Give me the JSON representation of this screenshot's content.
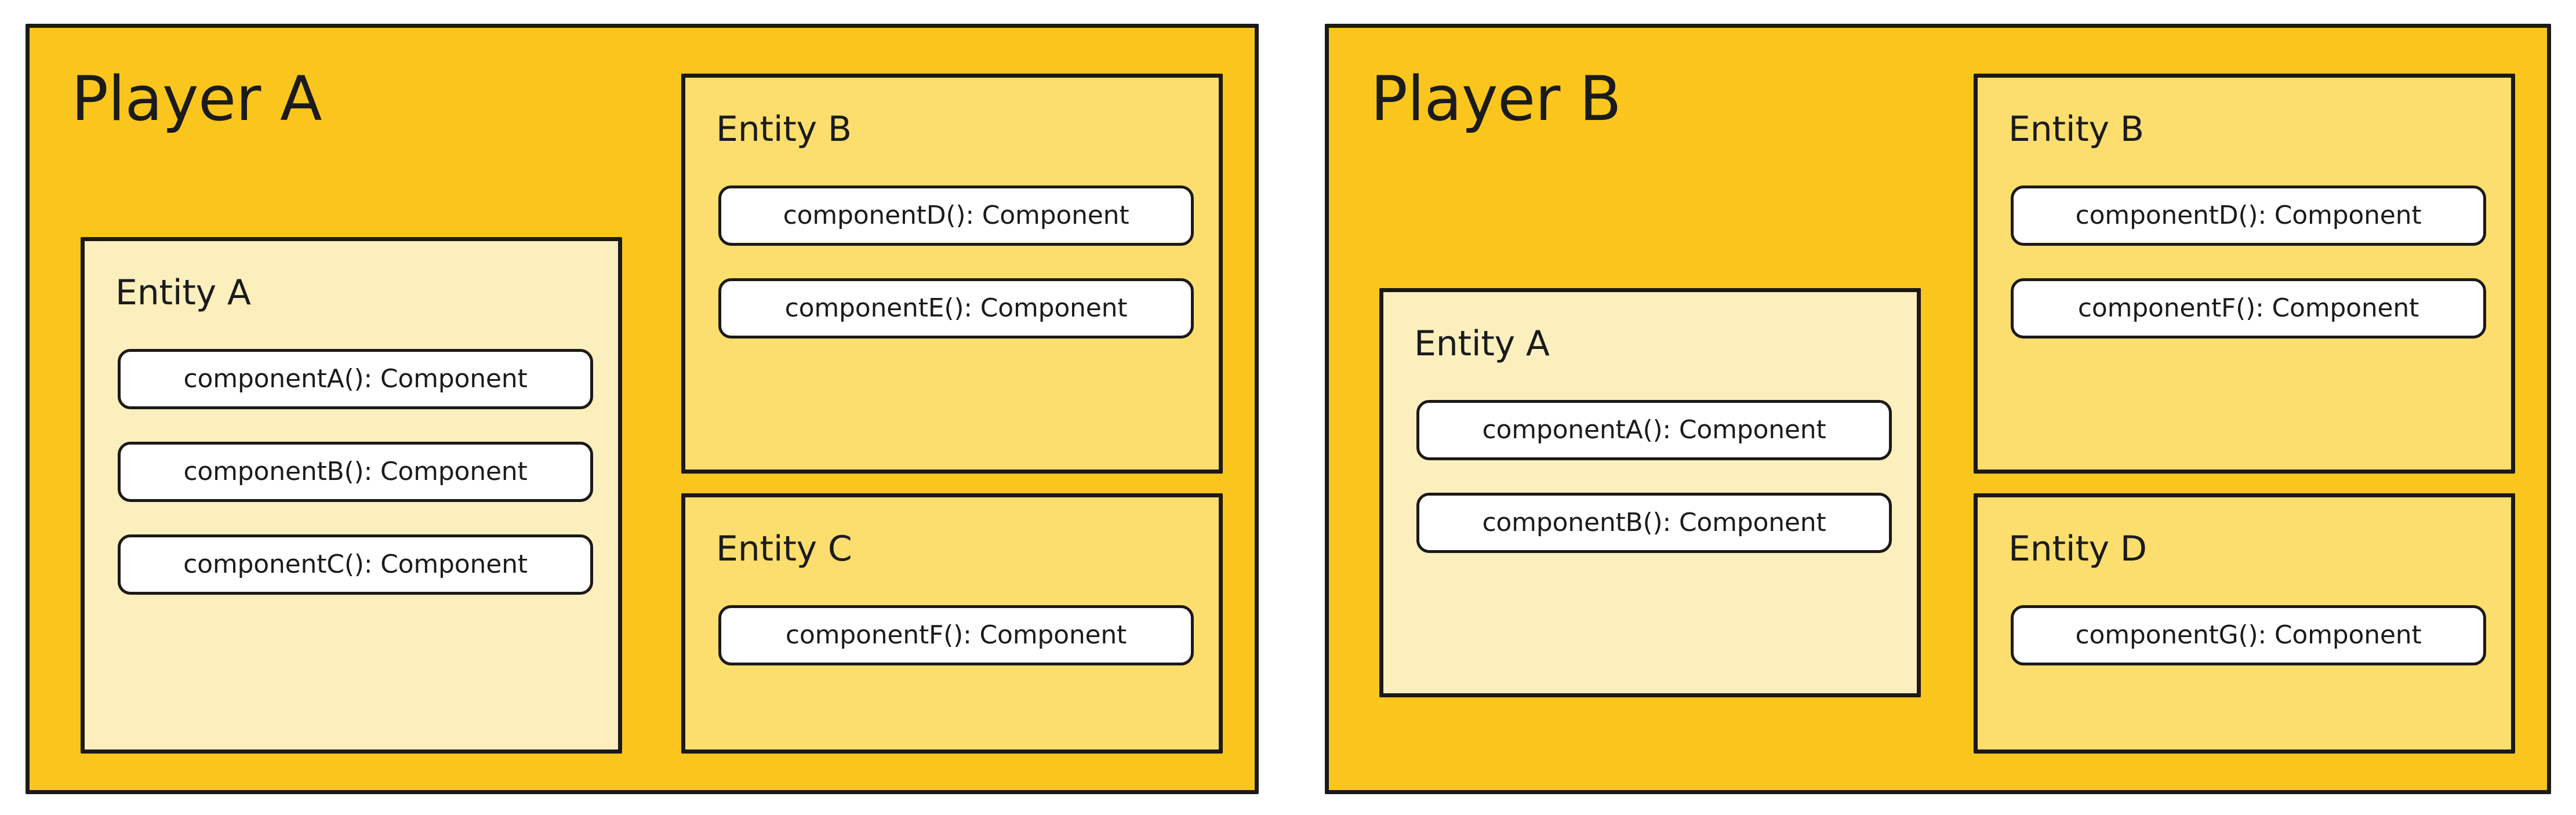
{
  "diagram": {
    "title_font_color": "#1b1b1b",
    "colors": {
      "player_fill": "#FAC61D",
      "entity_light_fill": "#FBEFBE",
      "entity_deep_fill": "#FCDE6E",
      "component_fill": "#FFFFFF",
      "stroke": "#1C1917",
      "page_background": "#FFFFFF"
    },
    "players": [
      {
        "id": "player-a",
        "label": "Player A",
        "entities": [
          {
            "id": "player-a-entity-a",
            "label": "Entity A",
            "tint": "light",
            "components": [
              {
                "label": "componentA(): Component"
              },
              {
                "label": "componentB(): Component"
              },
              {
                "label": "componentC(): Component"
              }
            ]
          },
          {
            "id": "player-a-entity-b",
            "label": "Entity B",
            "tint": "deep",
            "components": [
              {
                "label": "componentD(): Component"
              },
              {
                "label": "componentE(): Component"
              }
            ]
          },
          {
            "id": "player-a-entity-c",
            "label": "Entity C",
            "tint": "deep",
            "components": [
              {
                "label": "componentF(): Component"
              }
            ]
          }
        ]
      },
      {
        "id": "player-b",
        "label": "Player B",
        "entities": [
          {
            "id": "player-b-entity-a",
            "label": "Entity A",
            "tint": "light",
            "components": [
              {
                "label": "componentA(): Component"
              },
              {
                "label": "componentB(): Component"
              }
            ]
          },
          {
            "id": "player-b-entity-b",
            "label": "Entity B",
            "tint": "deep",
            "components": [
              {
                "label": "componentD(): Component"
              },
              {
                "label": "componentF(): Component"
              }
            ]
          },
          {
            "id": "player-b-entity-d",
            "label": "Entity D",
            "tint": "deep",
            "components": [
              {
                "label": "componentG(): Component"
              }
            ]
          }
        ]
      }
    ]
  }
}
